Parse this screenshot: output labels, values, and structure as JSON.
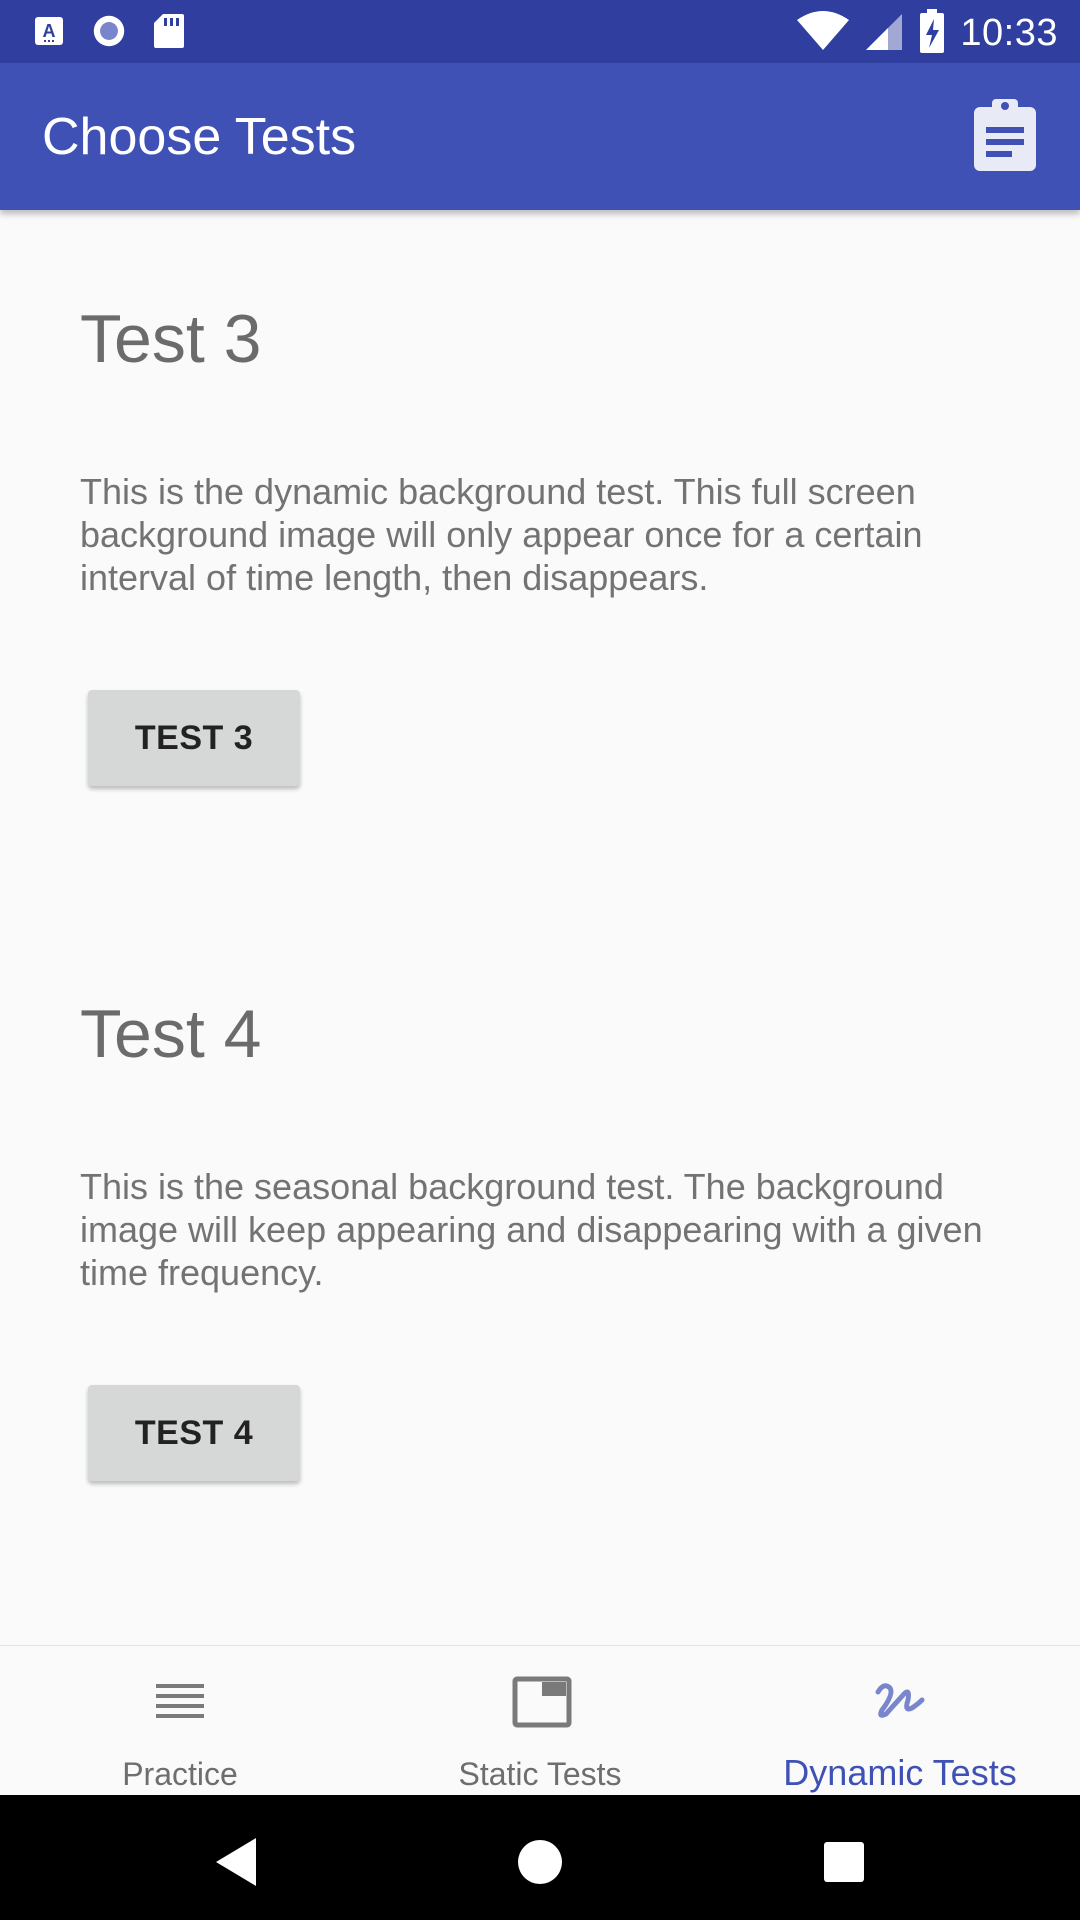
{
  "status_bar": {
    "time": "10:33",
    "left_icons": [
      "keyboard-a-icon",
      "radio-record-icon",
      "sd-card-icon"
    ],
    "right_icons": [
      "wifi-icon",
      "cell-signal-icon",
      "battery-charging-icon"
    ]
  },
  "app_bar": {
    "title": "Choose Tests",
    "action_icon": "clipboard-icon"
  },
  "sections": [
    {
      "title": "Test 3",
      "description": "This is the dynamic background test. This full screen background image will only appear once for a certain interval of time length, then disappears.",
      "button_label": "TEST 3"
    },
    {
      "title": "Test 4",
      "description": "This is the seasonal background test. The background image will keep appearing and disappearing with a given time frequency.",
      "button_label": "TEST 4"
    }
  ],
  "bottom_nav": {
    "items": [
      {
        "label": "Practice",
        "icon": "list-lines-icon",
        "active": false
      },
      {
        "label": "Static Tests",
        "icon": "window-icon",
        "active": false
      },
      {
        "label": "Dynamic Tests",
        "icon": "squiggle-icon",
        "active": true
      }
    ]
  },
  "colors": {
    "status_bar": "#303f9f",
    "app_bar": "#3f51b5",
    "accent": "#3f51b5",
    "background": "#fafafa",
    "button": "#d6d7d7"
  }
}
